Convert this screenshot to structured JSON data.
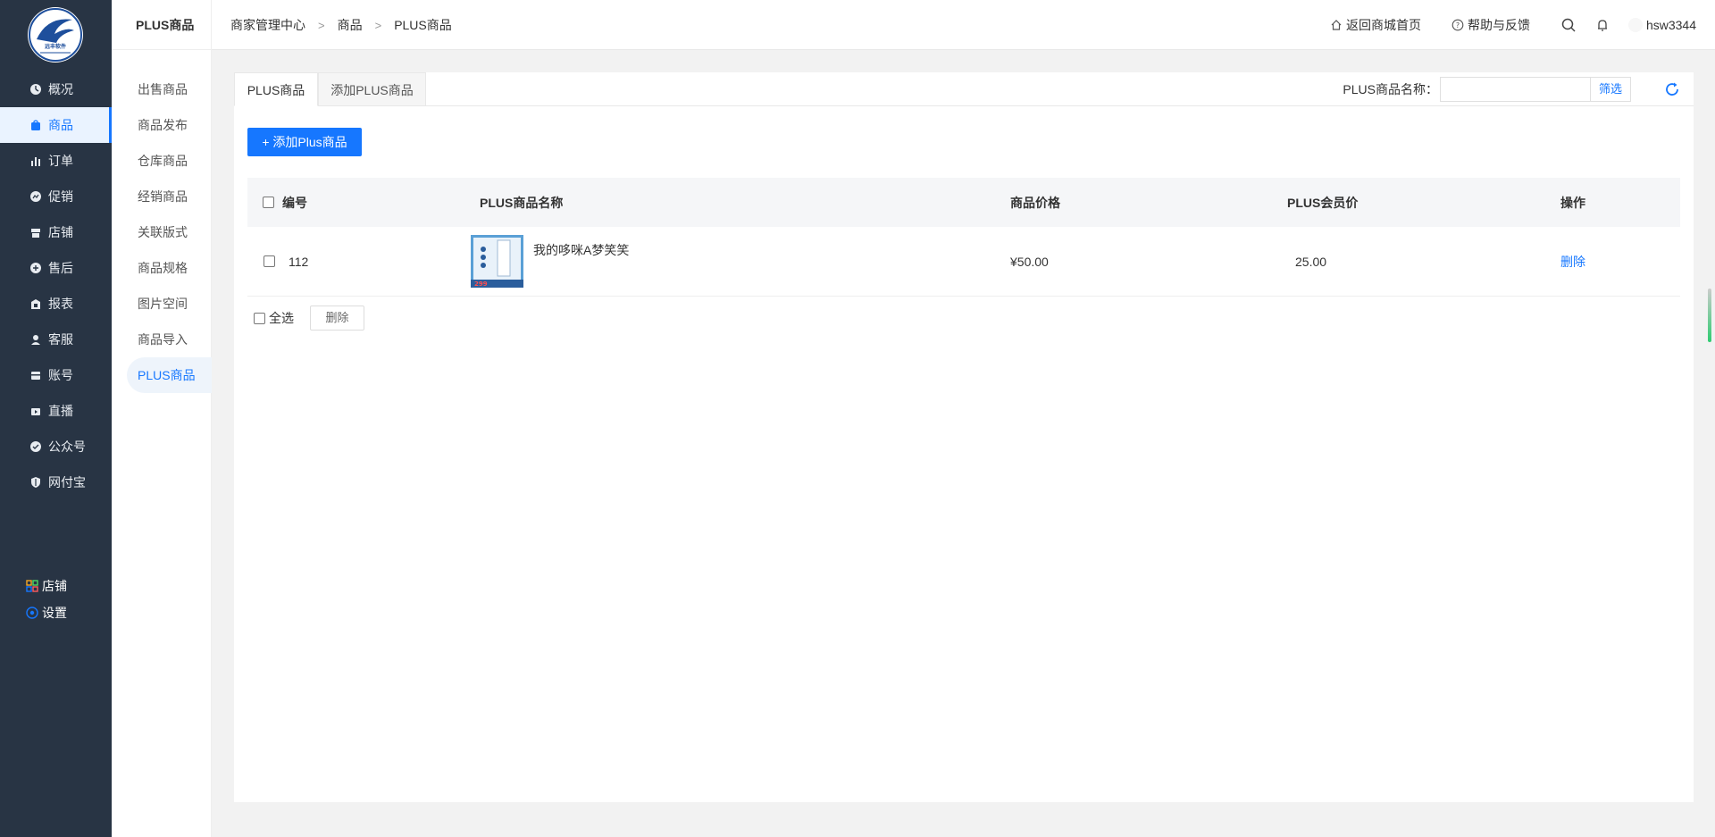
{
  "nav": {
    "logo_text": "远丰软件",
    "items": [
      {
        "label": "概况",
        "icon": "dashboard-icon"
      },
      {
        "label": "商品",
        "icon": "bag-icon"
      },
      {
        "label": "订单",
        "icon": "bar-chart-icon"
      },
      {
        "label": "促销",
        "icon": "promotion-icon"
      },
      {
        "label": "店铺",
        "icon": "store-icon"
      },
      {
        "label": "售后",
        "icon": "after-sale-icon"
      },
      {
        "label": "报表",
        "icon": "report-icon"
      },
      {
        "label": "客服",
        "icon": "service-icon"
      },
      {
        "label": "账号",
        "icon": "account-icon"
      },
      {
        "label": "直播",
        "icon": "live-icon"
      },
      {
        "label": "公众号",
        "icon": "official-account-icon"
      },
      {
        "label": "网付宝",
        "icon": "payment-icon"
      }
    ],
    "active_index": 1,
    "footer": [
      {
        "label": "店铺",
        "icon": "grid-icon"
      },
      {
        "label": "设置",
        "icon": "settings-icon"
      }
    ]
  },
  "submenu": {
    "title": "PLUS商品",
    "items": [
      "出售商品",
      "商品发布",
      "仓库商品",
      "经销商品",
      "关联版式",
      "商品规格",
      "图片空间",
      "商品导入",
      "PLUS商品"
    ],
    "active_index": 8
  },
  "header": {
    "breadcrumb": [
      "商家管理中心",
      "商品",
      "PLUS商品"
    ],
    "home_link": "返回商城首页",
    "help_link": "帮助与反馈",
    "username": "hsw3344"
  },
  "tabs": [
    "PLUS商品",
    "添加PLUS商品"
  ],
  "filter": {
    "label": "PLUS商品名称：",
    "value": "",
    "button": "筛选"
  },
  "add_button": "+ 添加Plus商品",
  "table": {
    "columns": [
      "编号",
      "PLUS商品名称",
      "商品价格",
      "PLUS会员价",
      "操作"
    ],
    "rows": [
      {
        "id": "112",
        "name": "我的哆咪A梦笑笑",
        "price": "¥50.00",
        "plus_price": "25.00",
        "action": "删除",
        "thumb_text": "299"
      }
    ]
  },
  "footer": {
    "select_all": "全选",
    "delete_button": "删除"
  },
  "colors": {
    "accent": "#1677ff",
    "nav_bg": "#283444"
  }
}
